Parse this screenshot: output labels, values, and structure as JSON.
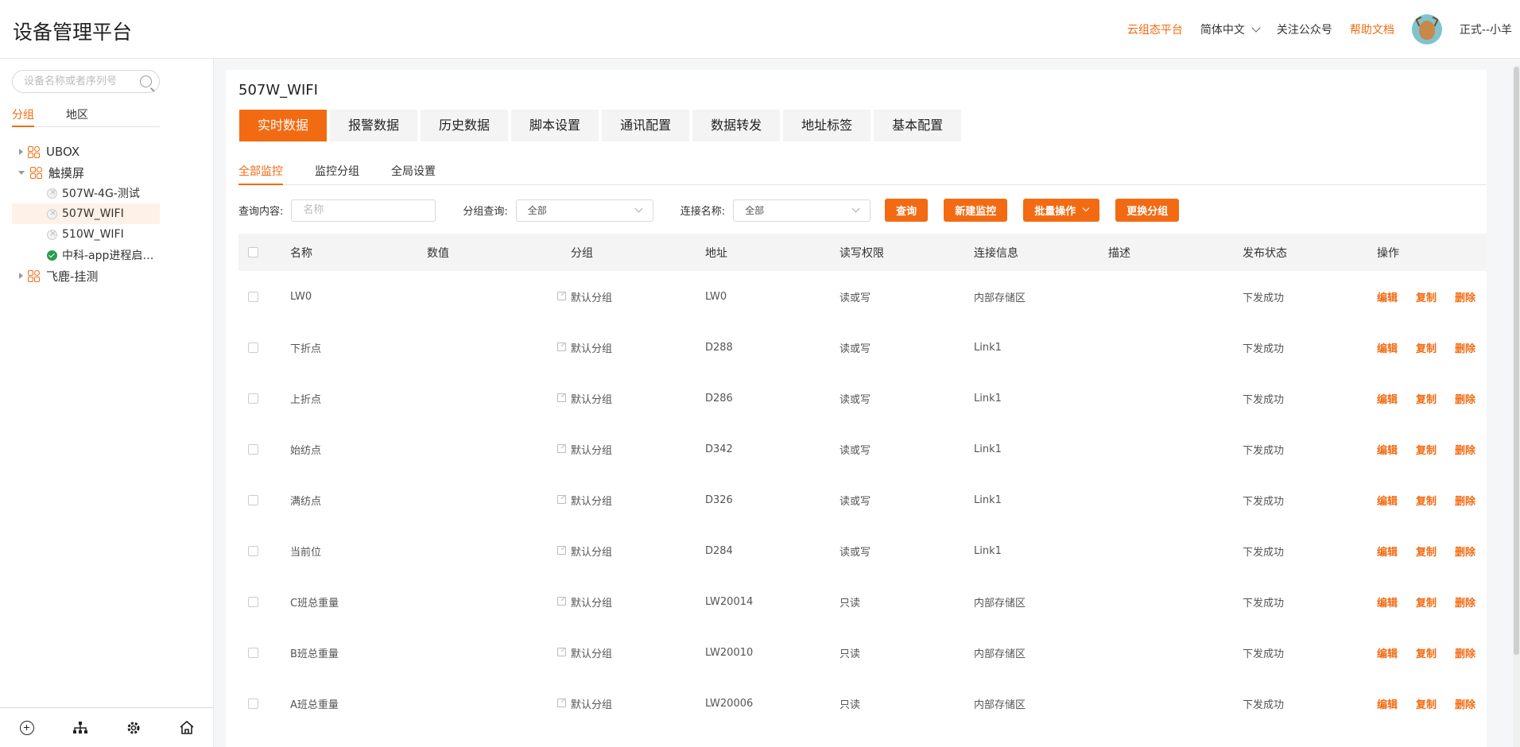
{
  "header": {
    "title": "设备管理平台",
    "links": {
      "cloud_platform": "云组态平台",
      "language": "简体中文",
      "follow": "关注公众号",
      "help": "帮助文档"
    },
    "user": "正式--小羊"
  },
  "sidebar": {
    "search_placeholder": "设备名称或者序列号",
    "tabs": [
      "分组",
      "地区"
    ],
    "tree": {
      "ubox": "UBOX",
      "touch": "触摸屏",
      "dev1": "507W-4G-测试",
      "dev2": "507W_WIFI",
      "dev3": "510W_WIFI",
      "dev4": "中科-app进程启…",
      "feilu": "飞鹿-挂测"
    }
  },
  "main": {
    "device_title": "507W_WIFI",
    "tabs": [
      "实时数据",
      "报警数据",
      "历史数据",
      "脚本设置",
      "通讯配置",
      "数据转发",
      "地址标签",
      "基本配置"
    ],
    "subtabs": [
      "全部监控",
      "监控分组",
      "全局设置"
    ],
    "filters": {
      "query_label": "查询内容:",
      "query_placeholder": "名称",
      "group_label": "分组查询:",
      "group_value": "全部",
      "conn_label": "连接名称:",
      "conn_value": "全部"
    },
    "buttons": {
      "query": "查询",
      "new": "新建监控",
      "batch": "批量操作",
      "change_group": "更换分组"
    },
    "columns": {
      "name": "名称",
      "value": "数值",
      "group": "分组",
      "addr": "地址",
      "rw": "读写权限",
      "link": "连接信息",
      "desc": "描述",
      "status": "发布状态",
      "ops": "操作"
    },
    "ops": {
      "edit": "编辑",
      "copy": "复制",
      "del": "删除"
    },
    "rows": [
      {
        "name": "LW0",
        "group": "默认分组",
        "addr": "LW0",
        "rw": "读或写",
        "link": "内部存储区",
        "status": "下发成功"
      },
      {
        "name": "下折点",
        "group": "默认分组",
        "addr": "D288",
        "rw": "读或写",
        "link": "Link1",
        "status": "下发成功"
      },
      {
        "name": "上折点",
        "group": "默认分组",
        "addr": "D286",
        "rw": "读或写",
        "link": "Link1",
        "status": "下发成功"
      },
      {
        "name": "始纺点",
        "group": "默认分组",
        "addr": "D342",
        "rw": "读或写",
        "link": "Link1",
        "status": "下发成功"
      },
      {
        "name": "满纺点",
        "group": "默认分组",
        "addr": "D326",
        "rw": "读或写",
        "link": "Link1",
        "status": "下发成功"
      },
      {
        "name": "当前位",
        "group": "默认分组",
        "addr": "D284",
        "rw": "读或写",
        "link": "Link1",
        "status": "下发成功"
      },
      {
        "name": "C班总重量",
        "group": "默认分组",
        "addr": "LW20014",
        "rw": "只读",
        "link": "内部存储区",
        "status": "下发成功"
      },
      {
        "name": "B班总重量",
        "group": "默认分组",
        "addr": "LW20010",
        "rw": "只读",
        "link": "内部存储区",
        "status": "下发成功"
      },
      {
        "name": "A班总重量",
        "group": "默认分组",
        "addr": "LW20006",
        "rw": "只读",
        "link": "内部存储区",
        "status": "下发成功"
      }
    ]
  },
  "colors": {
    "accent": "#f26b12",
    "online": "#2a9d4a"
  }
}
